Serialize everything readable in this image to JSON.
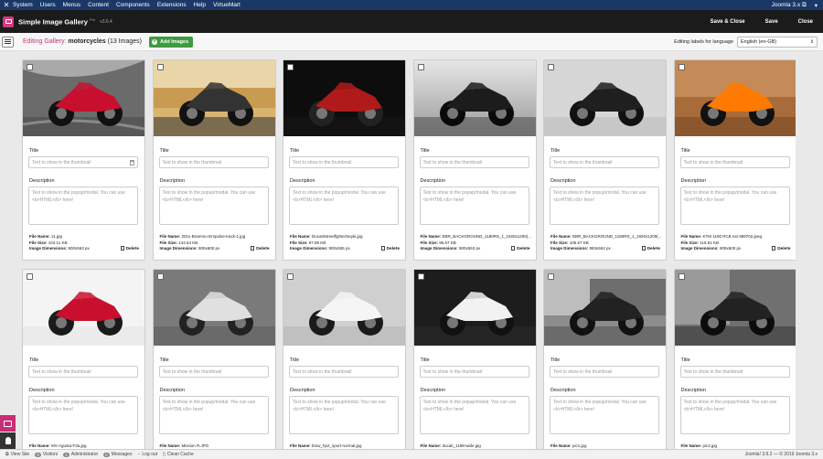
{
  "menubar": {
    "items": [
      "System",
      "Users",
      "Menus",
      "Content",
      "Components",
      "Extensions",
      "Help",
      "VirtueMart"
    ],
    "site_name": "Joomla 3.x",
    "external_icon": "external-link-icon",
    "user_icon": "user-icon"
  },
  "toolbar": {
    "app_title": "Simple Image Gallery",
    "app_title_suffix": "Pro",
    "version": "v3.6.4",
    "save_close": "Save & Close",
    "save": "Save",
    "close": "Close"
  },
  "subbar": {
    "editing_label": "Editing Gallery:",
    "gallery_name": "motorcycles",
    "image_count": "(13 Images)",
    "add_images": "Add Images",
    "lang_label": "Editing labels for language",
    "lang_value": "English (en-GB)"
  },
  "card_labels": {
    "title": "Title",
    "title_placeholder": "Text to show in the thumbnail",
    "description": "Description",
    "description_placeholder": "Text to show in the popup/modal. You can use <b>HTML</b> here!",
    "file_name": "File Name:",
    "file_size": "File Size:",
    "image_dimensions": "Image Dimensions:",
    "delete": "Delete"
  },
  "cards": [
    {
      "file_name": "11.jpg",
      "file_size": "104.11 KB",
      "dimensions": "900x563 px",
      "scene": "track-red"
    },
    {
      "file_name": "2011-Brammo-Empulse-track-1.jpg",
      "file_size": "144.64 KB",
      "dimensions": "900x600 px",
      "scene": "road-rider"
    },
    {
      "file_name": "DucatiStreetfighterSeyki.jpg",
      "file_size": "97.88 KB",
      "dimensions": "900x506 px",
      "scene": "black-red"
    },
    {
      "file_name": "EBR_BACKGROUND_1180RS_1_1920x1200(...",
      "file_size": "95.67 KB",
      "dimensions": "900x563 px",
      "scene": "studio-dark"
    },
    {
      "file_name": "EBR_BACKGROUND_1180RS_1_1920x1200(...",
      "file_size": "105.57 KB",
      "dimensions": "983x563 px",
      "scene": "studio-light"
    },
    {
      "file_name": "KTM 1190 RC8 Ast-389702.jpeg",
      "file_size": "116.91 KB",
      "dimensions": "908x600 px",
      "scene": "orange-rider"
    },
    {
      "file_name": "MV-Agusta-F3a.jpg",
      "file_size": "",
      "dimensions": "",
      "scene": "white-red"
    },
    {
      "file_name": "Mission R.JPG",
      "file_size": "",
      "dimensions": "",
      "scene": "grey-studio"
    },
    {
      "file_name": "bmw_hp2_sport-normal.jpg",
      "file_size": "",
      "dimensions": "",
      "scene": "white-bike"
    },
    {
      "file_name": "ducati_1198-wide.jpg",
      "file_size": "",
      "dimensions": "",
      "scene": "white-sport"
    },
    {
      "file_name": "pic1.jpg",
      "file_size": "",
      "dimensions": "",
      "scene": "city-wheelie"
    },
    {
      "file_name": "pic2.jpg",
      "file_size": "",
      "dimensions": "",
      "scene": "street-bw"
    }
  ],
  "statusbar": {
    "view_site": "View Site",
    "visitors_count": "0",
    "visitors": "Visitors",
    "admins_count": "1",
    "admins": "Administrator",
    "messages_count": "0",
    "messages": "Messages",
    "logout": "Log out",
    "clean_cache": "Clean Cache",
    "right_text": "Joomla! 3.9.2 — © 2019 Joomla 3.x"
  },
  "colors": {
    "accent": "#c62f74",
    "menubar": "#1a3867",
    "toolbar": "#1b1b1b",
    "add_button": "#3e9b3e"
  }
}
